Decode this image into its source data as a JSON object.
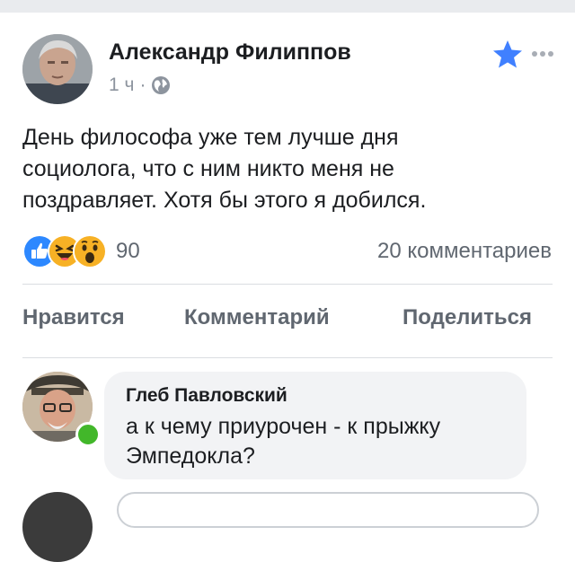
{
  "post": {
    "author": "Александр Филиппов",
    "time": "1 ч",
    "separator": "·",
    "audience_icon": "globe-icon",
    "header_icons": [
      "star-icon",
      "more-icon"
    ],
    "text_lines": [
      "День философа уже тем лучше дня",
      "социолога, что с ним никто меня не",
      "поздравляет. Хотя бы этого я добился."
    ],
    "reactions": {
      "icons": [
        "like-icon",
        "haha-icon",
        "wow-icon"
      ],
      "count": "90"
    },
    "comments_count": "20 комментариев",
    "actions": {
      "like": "Нравится",
      "comment": "Комментарий",
      "share": "Поделиться"
    }
  },
  "comment": {
    "author": "Глеб Павловский",
    "text_lines": [
      "а к чему приурочен - к прыжку",
      "Эмпедокла?"
    ],
    "online": true
  },
  "colors": {
    "star": "#4080ff",
    "like": "#2d88ff",
    "emoji": "#f7b125",
    "online": "#42b72a",
    "secondary_text": "#606770",
    "bubble": "#f2f3f5"
  }
}
